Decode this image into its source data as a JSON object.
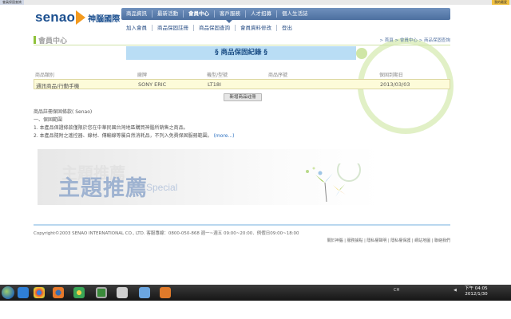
{
  "browser": {
    "tab_title": "會員保固查詢",
    "favorite_label": "我的最愛"
  },
  "logo": {
    "brand": "senao",
    "cn": "神腦國際"
  },
  "top_nav": [
    "商品資訊",
    "最新活動",
    "會員中心",
    "客戶服務",
    "人才招募",
    "個人生活誌"
  ],
  "sub_nav": [
    "加入會員",
    "商品保固註冊",
    "商品保固查詢",
    "會員資料修改",
    "登出"
  ],
  "page_title": "會員中心",
  "breadcrumb": "> 首頁 > 會員中心 > 商品保固查詢",
  "section_title": "§ 商品保固紀錄 §",
  "table": {
    "headers": [
      "商品類別",
      "廠牌",
      "機型/型號",
      "商品序號",
      "保固到期日"
    ],
    "rows": [
      [
        "通訊商品/行動手機",
        "SONY ERIC",
        "LT18I",
        "",
        "2013/03/03"
      ]
    ]
  },
  "add_button": "新增商品註冊",
  "warranty": {
    "heading": "商品註冊保固條款( Senao)",
    "sub": "一、保固範圍",
    "item1": "1. 本產品保證條款僅限於您在中華民國台灣地區購買神腦所銷售之商品。",
    "item2": "2. 本產品隨附之遙控器、線材、傳輸線等屬自然消耗品，不列入免費保固服務範圍。",
    "more": "(more...)"
  },
  "feature": {
    "watermark": "主題推薦",
    "title": "主題推薦",
    "subtitle": "Special"
  },
  "footer": {
    "copyright": "Copyright©2003 SENAO INTERNATIONAL CO., LTD. 客服專線：0800-050-868 週一~週五 09:00~20:00．例假日09:00~18:00",
    "links": "關於神腦 | 服務據點 | 隱私權聲明 | 隱私權保護 | 網站地圖 | 聯絡我們"
  },
  "taskbar": {
    "ime": "CH",
    "time": "下午 04:05",
    "date": "2012/1/30"
  },
  "colors": {
    "brand_blue": "#1b4f8f",
    "brand_orange": "#f39a1e",
    "nav_blue": "#4c6f9f",
    "accent_green": "#8fc23a",
    "banner_blue": "#b9ddf5"
  }
}
